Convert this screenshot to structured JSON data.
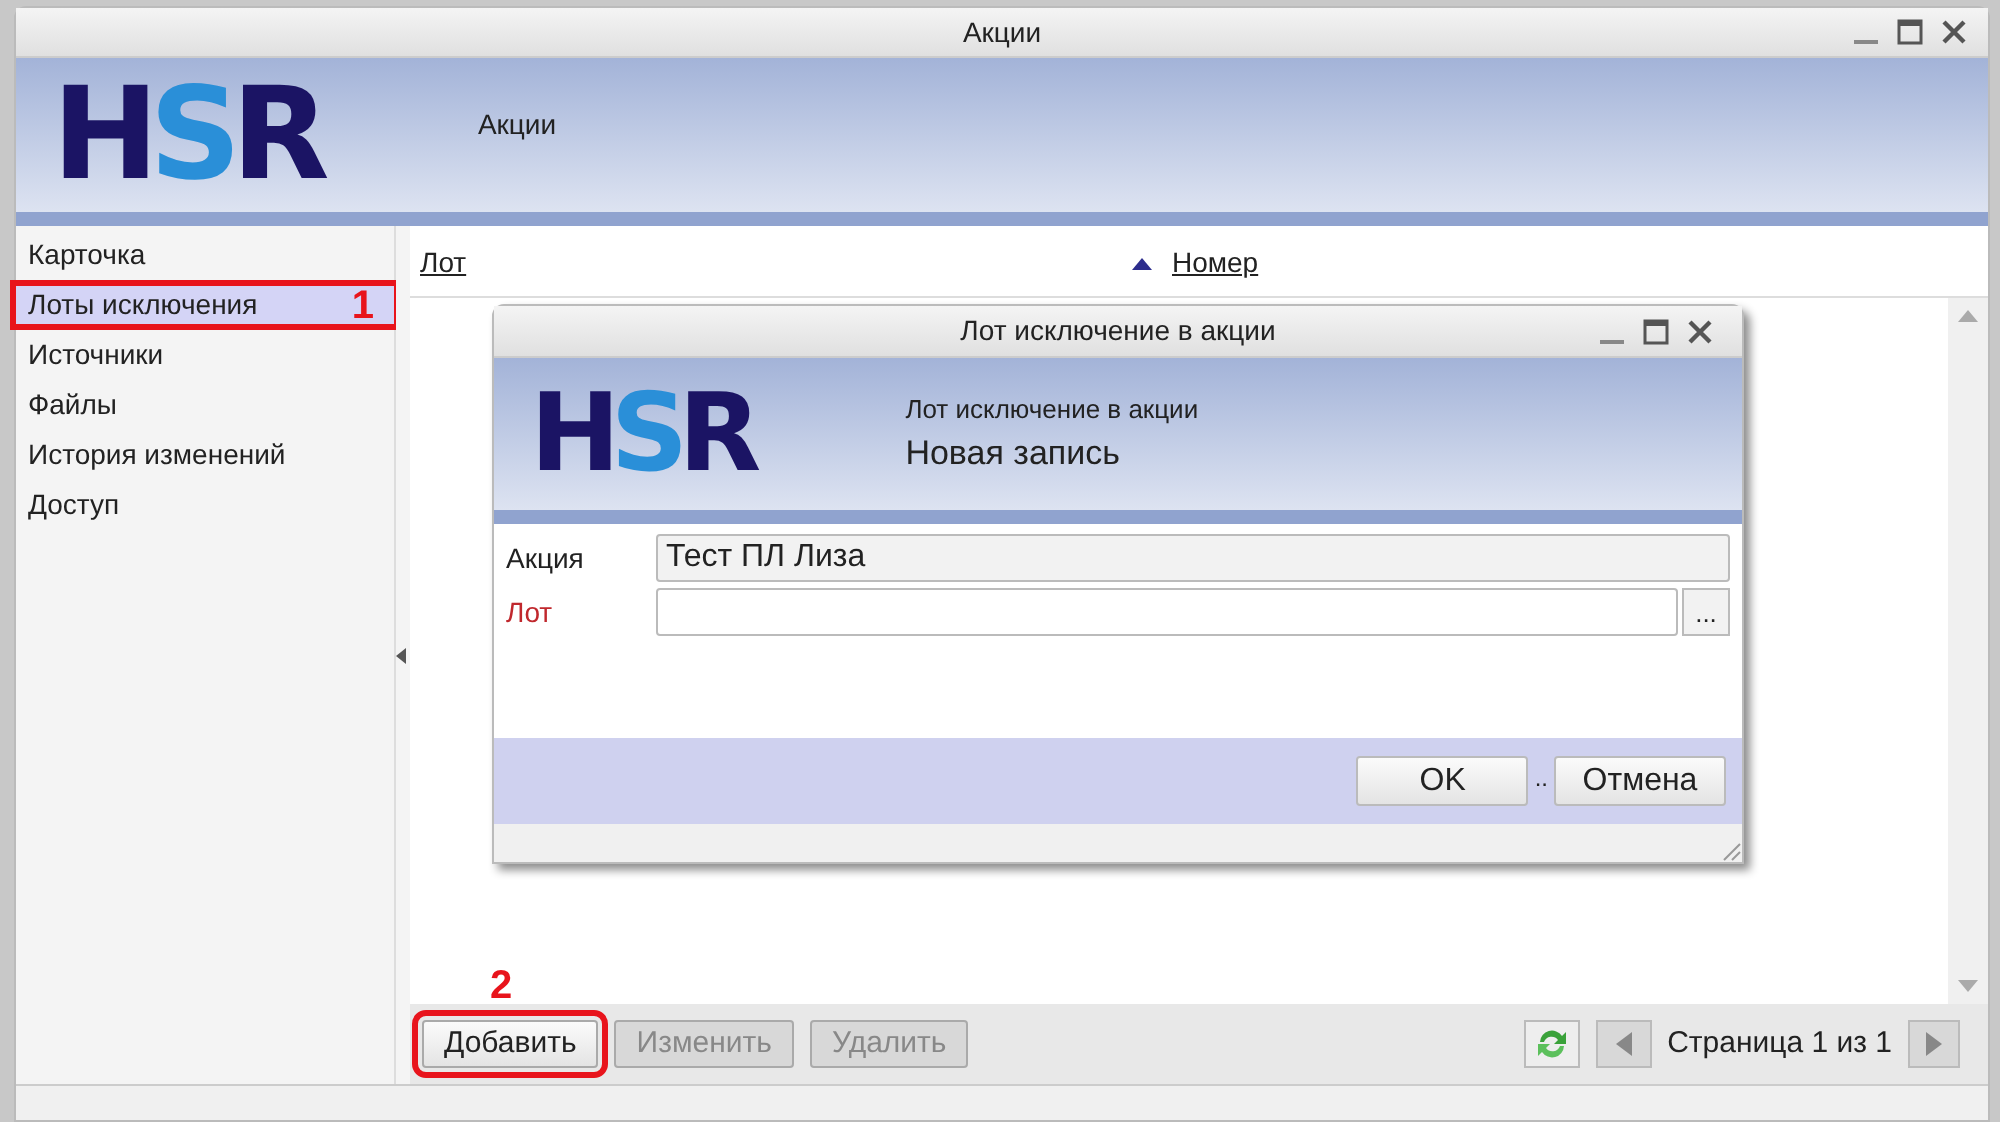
{
  "window": {
    "title": "Акции",
    "header_title": "Акции",
    "logo": "HSR"
  },
  "sidebar": {
    "items": [
      {
        "label": "Карточка",
        "selected": false
      },
      {
        "label": "Лоты исключения",
        "selected": true,
        "annotation": "1"
      },
      {
        "label": "Источники",
        "selected": false
      },
      {
        "label": "Файлы",
        "selected": false
      },
      {
        "label": "История изменений",
        "selected": false
      },
      {
        "label": "Доступ",
        "selected": false
      }
    ]
  },
  "table": {
    "columns": [
      {
        "label": "Лот",
        "sorted": false
      },
      {
        "label": "Номер",
        "sorted": true
      }
    ]
  },
  "toolbar": {
    "buttons": [
      {
        "label": "Добавить",
        "disabled": false,
        "annotation": "2"
      },
      {
        "label": "Изменить",
        "disabled": true
      },
      {
        "label": "Удалить",
        "disabled": true
      }
    ],
    "page_label": "Страница 1 из 1"
  },
  "dialog": {
    "title": "Лот исключение в акции",
    "logo": "HSR",
    "subtitle": "Лот исключение в акции",
    "heading": "Новая запись",
    "fields": [
      {
        "label": "Акция",
        "value": "Тест ПЛ Лиза",
        "required": false,
        "kind": "readonly"
      },
      {
        "label": "Лот",
        "required": true,
        "kind": "picker",
        "button": "..."
      }
    ],
    "buttons": [
      "OK",
      "Отмена"
    ],
    "separator": ".."
  }
}
